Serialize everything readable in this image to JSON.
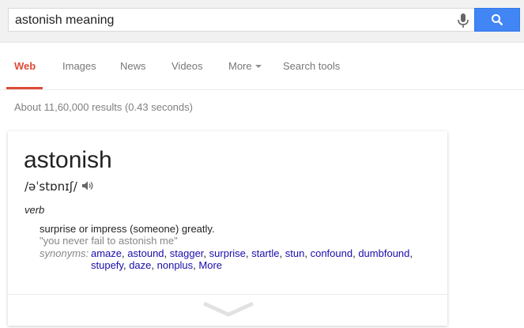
{
  "search": {
    "query": "astonish meaning"
  },
  "tabs": [
    {
      "label": "Web"
    },
    {
      "label": "Images"
    },
    {
      "label": "News"
    },
    {
      "label": "Videos"
    },
    {
      "label": "More"
    },
    {
      "label": "Search tools"
    }
  ],
  "stats": "About 11,60,000 results (0.43 seconds)",
  "card": {
    "word": "astonish",
    "phonetic": "/əˈstɒnɪʃ/",
    "part_of_speech": "verb",
    "definition": "surprise or impress (someone) greatly.",
    "example": "\"you never fail to astonish me\"",
    "synonyms_label": "synonyms:",
    "synonyms": [
      "amaze",
      "astound",
      "stagger",
      "surprise",
      "startle",
      "stun",
      "confound",
      "dumbfound",
      "stupefy",
      "daze",
      "nonplus"
    ],
    "more_label": "More"
  },
  "colors": {
    "accent_active_tab": "#dd4b39",
    "search_button": "#4285f4",
    "link": "#1a0dab"
  }
}
